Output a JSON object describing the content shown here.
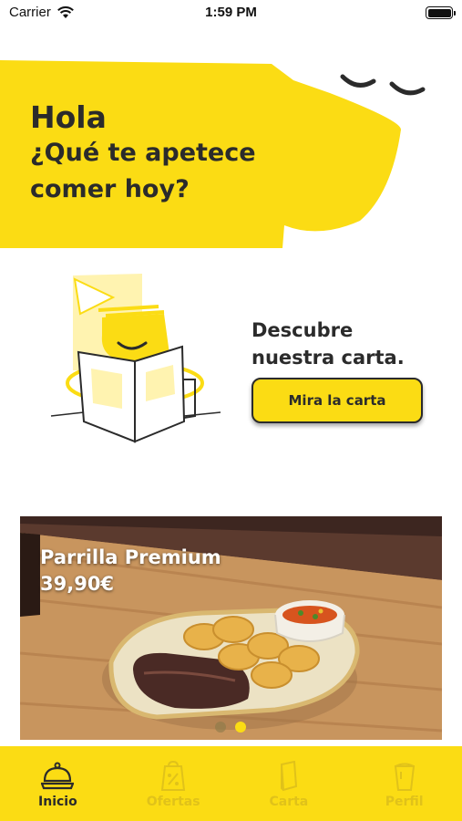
{
  "status_bar": {
    "carrier": "Carrier",
    "time": "1:59 PM"
  },
  "hero": {
    "greeting": "Hola",
    "question": "¿Qué te apetece comer hoy?"
  },
  "menu_section": {
    "title": "Descubre nuestra carta.",
    "button_label": "Mira la carta"
  },
  "promo": {
    "title": "Parrilla Premium",
    "price": "39,90€",
    "carousel_total": 2,
    "carousel_active_index": 1
  },
  "tab_bar": {
    "items": [
      {
        "label": "Inicio",
        "icon": "cloche-icon",
        "active": true
      },
      {
        "label": "Ofertas",
        "icon": "discount-bag-icon",
        "active": false
      },
      {
        "label": "Carta",
        "icon": "menu-book-icon",
        "active": false
      },
      {
        "label": "Perfil",
        "icon": "profile-cup-icon",
        "active": false
      }
    ]
  },
  "colors": {
    "brand_yellow": "#fbdc14",
    "text_dark": "#2b2b2b",
    "inactive_tab": "#e0c21a"
  }
}
